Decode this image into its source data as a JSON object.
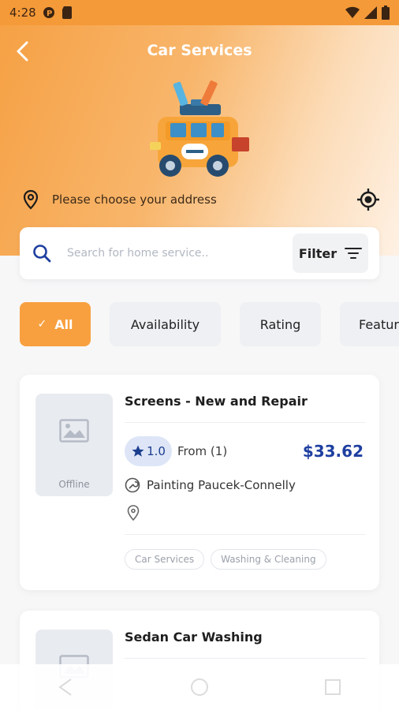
{
  "status_bar": {
    "time": "4:28"
  },
  "header": {
    "title": "Car Services"
  },
  "address": {
    "text": "Please choose your address"
  },
  "search": {
    "placeholder": "Search for home service..",
    "filter_label": "Filter"
  },
  "chips": [
    {
      "label": "All",
      "active": true
    },
    {
      "label": "Availability",
      "active": false
    },
    {
      "label": "Rating",
      "active": false
    },
    {
      "label": "Featured",
      "active": false
    }
  ],
  "services": [
    {
      "title": "Screens - New and Repair",
      "thumb_status": "Offline",
      "rating": "1.0",
      "from": "From (1)",
      "price": "$33.62",
      "provider": "Painting Paucek-Connelly",
      "tags": [
        "Car Services",
        "Washing & Cleaning"
      ]
    },
    {
      "title": "Sedan Car Washing"
    }
  ],
  "colors": {
    "accent": "#f8a03f",
    "price": "#1e3fa0",
    "rating_bg": "#dde5f7"
  },
  "icons": [
    "back-arrow-icon",
    "location-pin-icon",
    "gps-target-icon",
    "search-icon",
    "filter-icon",
    "check-icon",
    "image-placeholder-icon",
    "star-icon",
    "wrench-icon"
  ]
}
